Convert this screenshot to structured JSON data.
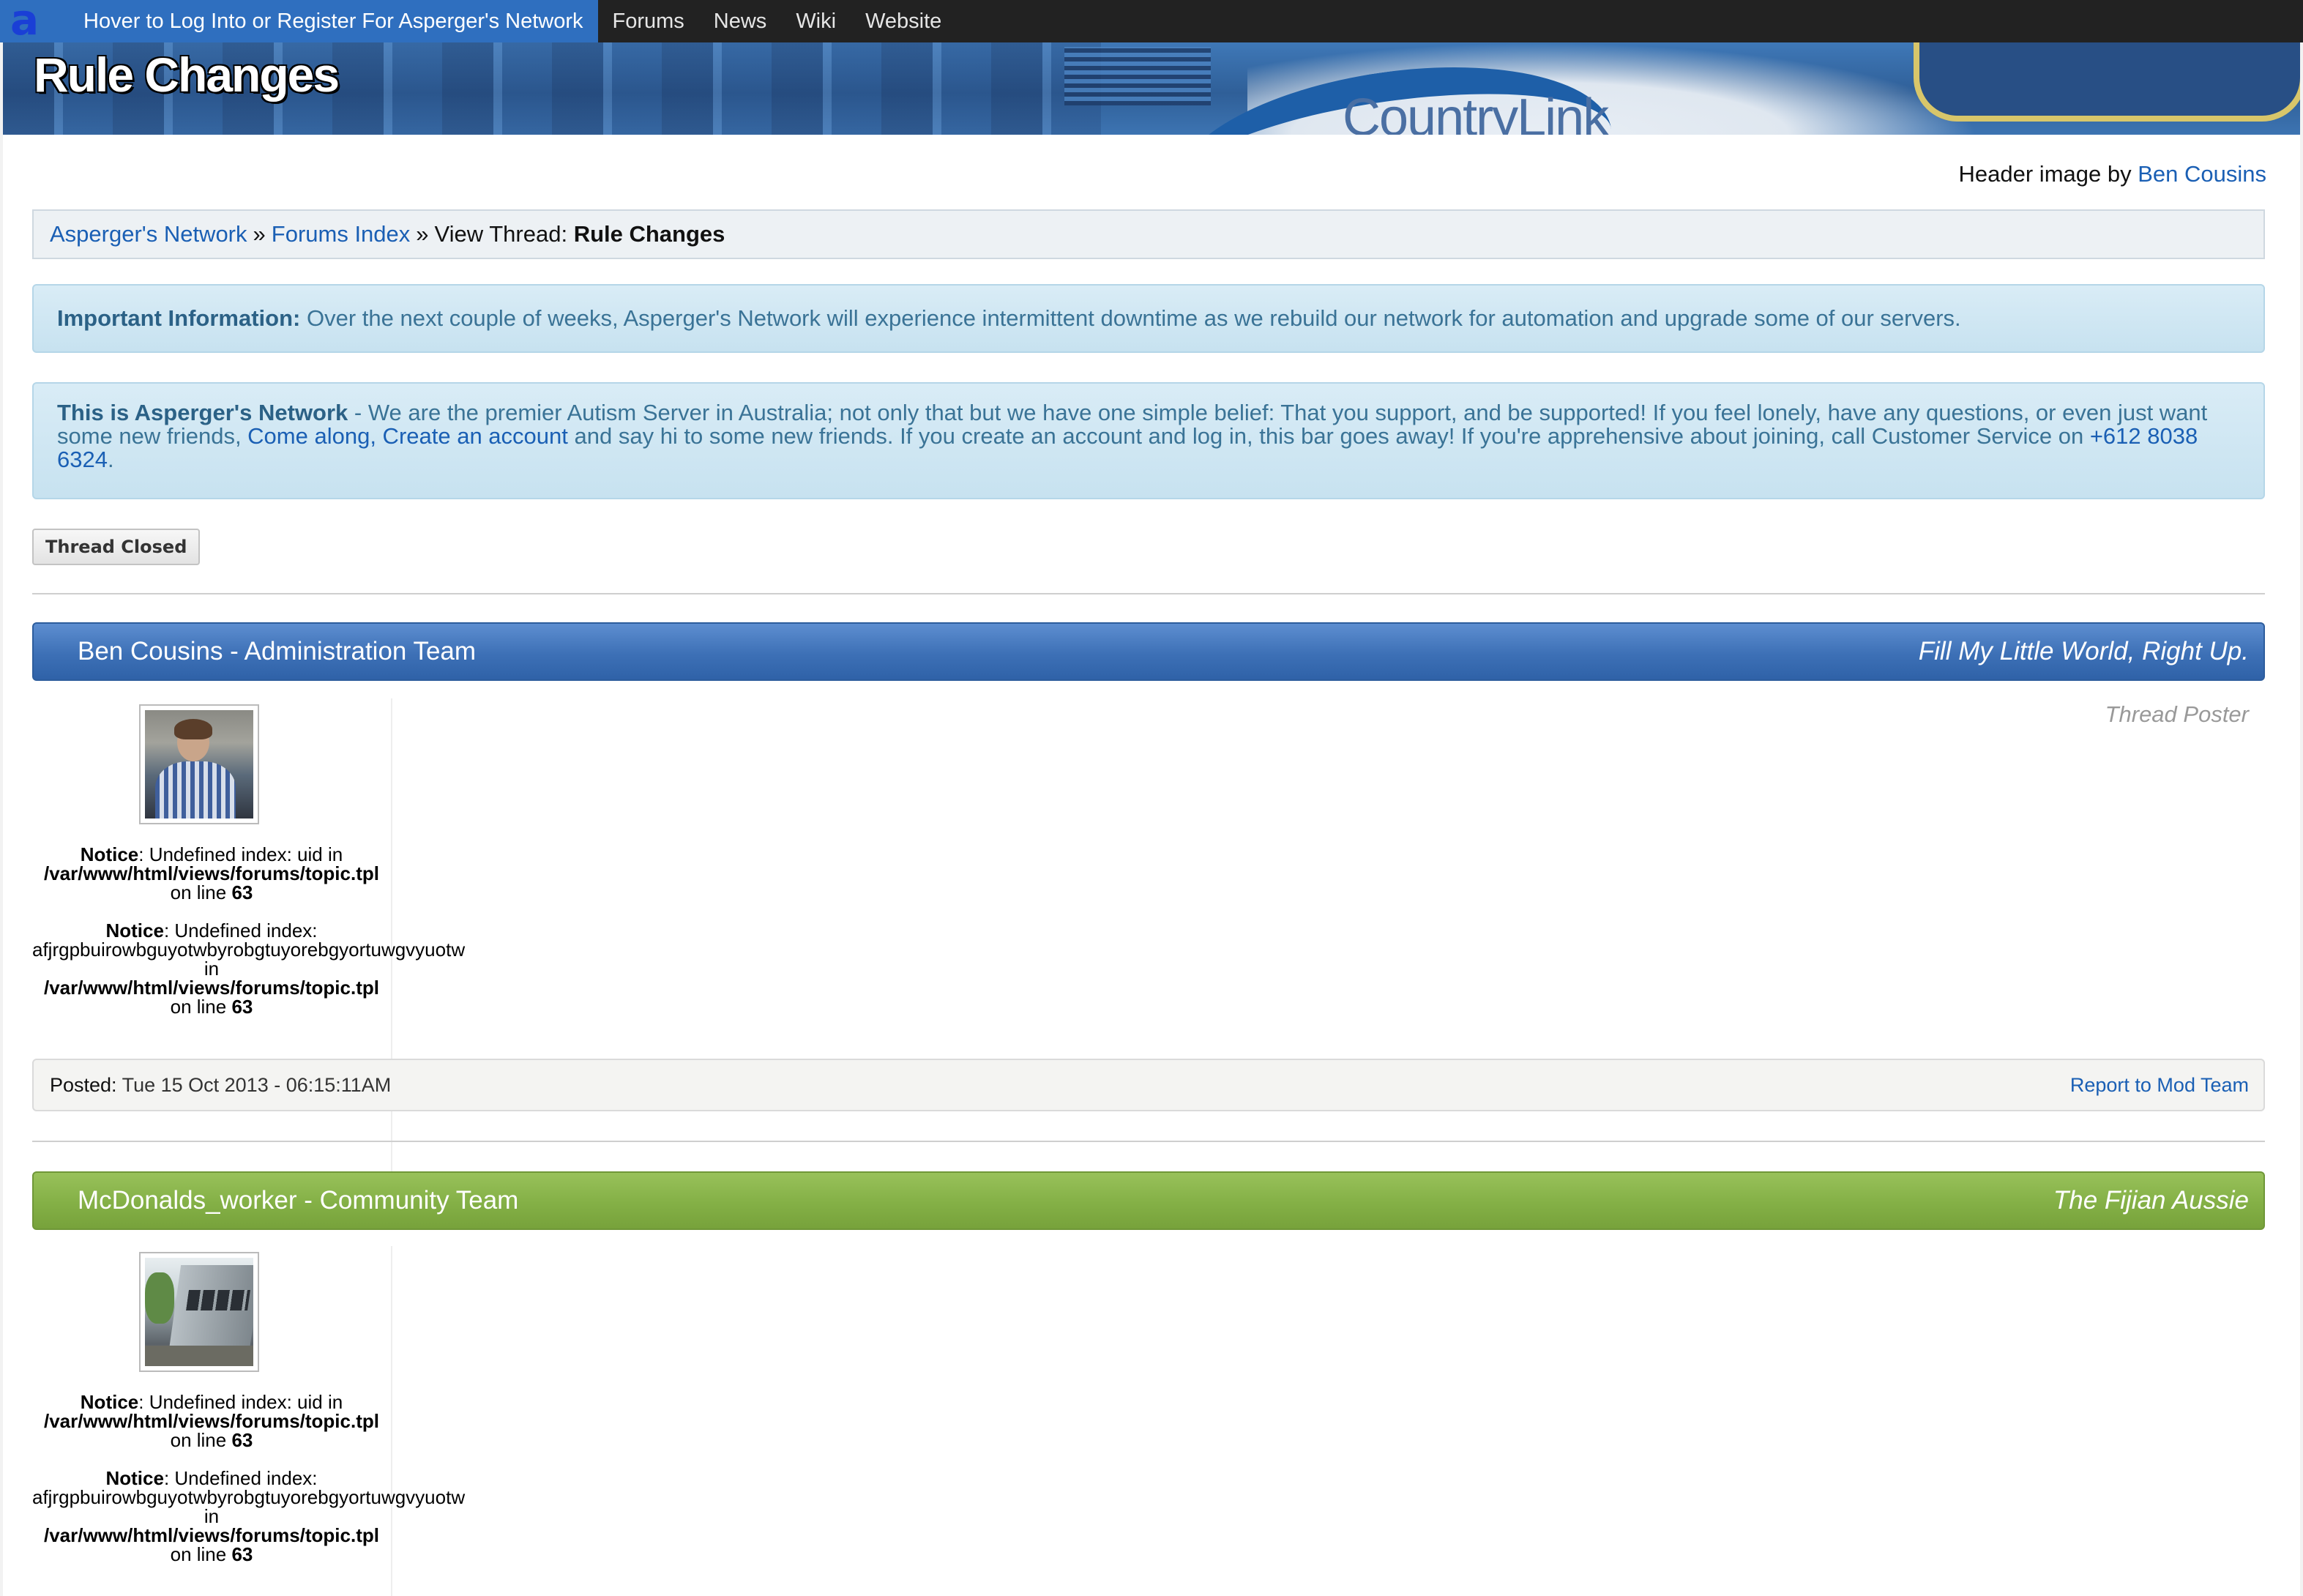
{
  "topbar": {
    "login_text": "Hover to Log Into or Register For Asperger's Network",
    "nav": [
      "Forums",
      "News",
      "Wiki",
      "Website"
    ]
  },
  "header": {
    "title": "Rule Changes",
    "brand_text": "CountryLink"
  },
  "credit": {
    "prefix": "Header image by",
    "author": "Ben Cousins"
  },
  "breadcrumb": {
    "items": [
      "Asperger's Network",
      "Forums Index"
    ],
    "separator": "»",
    "current_prefix": "View Thread:",
    "current": "Rule Changes"
  },
  "important": {
    "label": "Important Information:",
    "text": "Over the next couple of weeks, Asperger's Network will experience intermittent downtime as we rebuild our network for automation and upgrade some of our servers."
  },
  "welcome": {
    "title": "This is Asperger's Network",
    "text1": " - We are the premier Autism Server in Australia; not only that but we have one simple belief: That you support, and be supported! If you feel lonely, have any questions, or even just want some new friends, ",
    "link1": "Come along, Create an account",
    "text2": " and say hi to some new friends. If you create an account and log in, this bar goes away! If you're apprehensive about joining, call Customer Service on ",
    "phone": "+612 8038 6324",
    "text3": "."
  },
  "thread_status": "Thread Closed",
  "posts": [
    {
      "author": "Ben Cousins - Administration Team",
      "tagline": "Fill My Little World, Right Up.",
      "role": "Thread Poster",
      "notice1": {
        "label": "Notice",
        "text": ": Undefined index: uid in",
        "path": "/var/www/html/views/forums/topic.tpl",
        "line_prefix": "on line",
        "line": "63"
      },
      "notice2": {
        "label": "Notice",
        "text": ": Undefined index:",
        "key": "afjrgpbuirowbguyotwbyrobgtuyorebgyortuwgvyuotw",
        "in": "in",
        "path": "/var/www/html/views/forums/topic.tpl",
        "line_prefix": "on line",
        "line": "63"
      },
      "posted_label": "Posted:",
      "posted_date": "Tue 15 Oct 2013 - 06:15:11AM",
      "report": "Report to Mod Team"
    },
    {
      "author": "McDonalds_worker - Community Team",
      "tagline": "The Fijian Aussie",
      "notice1": {
        "label": "Notice",
        "text": ": Undefined index: uid in",
        "path": "/var/www/html/views/forums/topic.tpl",
        "line_prefix": "on line",
        "line": "63"
      },
      "notice2": {
        "label": "Notice",
        "text": ": Undefined index:",
        "key": "afjrgpbuirowbguyotwbyrobgtuyorebgyortuwgvyuotw",
        "in": "in",
        "path": "/var/www/html/views/forums/topic.tpl",
        "line_prefix": "on line",
        "line": "63"
      }
    }
  ],
  "colors": {
    "topbar": "#222222",
    "login_bg": "#2f6fbf",
    "link": "#1a5fb4",
    "admin_header": "#3d70b6",
    "community_header": "#84b046",
    "info_text": "#3a7396"
  }
}
